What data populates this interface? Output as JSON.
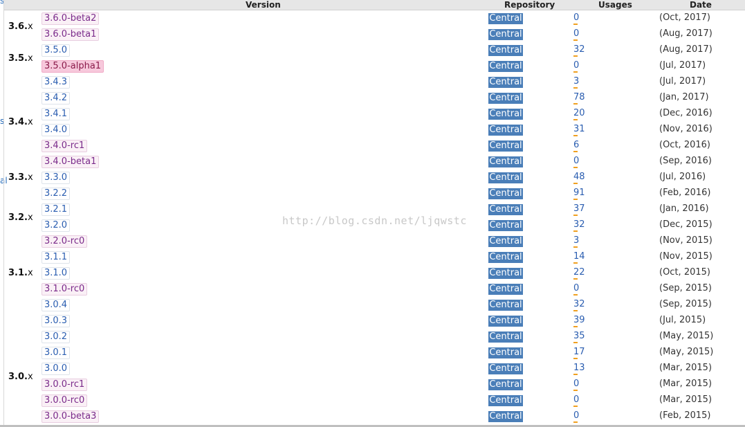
{
  "headers": {
    "version": "Version",
    "repository": "Repository",
    "usages": "Usages",
    "date": "Date"
  },
  "edge_text": [
    "s",
    "s",
    "al"
  ],
  "watermark": "http://blog.csdn.net/ljqwstc",
  "groups": [
    {
      "major": "3.6.",
      "suffix": "x"
    },
    {
      "major": "3.5.",
      "suffix": "x"
    },
    {
      "major": "3.4.",
      "suffix": "x"
    },
    {
      "major": "3.3.",
      "suffix": "x"
    },
    {
      "major": "3.2.",
      "suffix": "x"
    },
    {
      "major": "3.1.",
      "suffix": "x"
    },
    {
      "major": "3.0.",
      "suffix": "x"
    }
  ],
  "rows": [
    {
      "version": "3.6.0-beta2",
      "kind": "pre",
      "repository": "Central",
      "usages": "0",
      "date": "(Oct, 2017)"
    },
    {
      "version": "3.6.0-beta1",
      "kind": "pre",
      "repository": "Central",
      "usages": "0",
      "date": "(Aug, 2017)"
    },
    {
      "version": "3.5.0",
      "kind": "release",
      "repository": "Central",
      "usages": "32",
      "date": "(Aug, 2017)"
    },
    {
      "version": "3.5.0-alpha1",
      "kind": "alpha",
      "repository": "Central",
      "usages": "0",
      "date": "(Jul, 2017)"
    },
    {
      "version": "3.4.3",
      "kind": "release",
      "repository": "Central",
      "usages": "3",
      "date": "(Jul, 2017)"
    },
    {
      "version": "3.4.2",
      "kind": "release",
      "repository": "Central",
      "usages": "78",
      "date": "(Jan, 2017)"
    },
    {
      "version": "3.4.1",
      "kind": "release",
      "repository": "Central",
      "usages": "20",
      "date": "(Dec, 2016)"
    },
    {
      "version": "3.4.0",
      "kind": "release",
      "repository": "Central",
      "usages": "31",
      "date": "(Nov, 2016)"
    },
    {
      "version": "3.4.0-rc1",
      "kind": "pre",
      "repository": "Central",
      "usages": "6",
      "date": "(Oct, 2016)"
    },
    {
      "version": "3.4.0-beta1",
      "kind": "pre",
      "repository": "Central",
      "usages": "0",
      "date": "(Sep, 2016)"
    },
    {
      "version": "3.3.0",
      "kind": "release",
      "repository": "Central",
      "usages": "48",
      "date": "(Jul, 2016)"
    },
    {
      "version": "3.2.2",
      "kind": "release",
      "repository": "Central",
      "usages": "91",
      "date": "(Feb, 2016)"
    },
    {
      "version": "3.2.1",
      "kind": "release",
      "repository": "Central",
      "usages": "37",
      "date": "(Jan, 2016)"
    },
    {
      "version": "3.2.0",
      "kind": "release",
      "repository": "Central",
      "usages": "32",
      "date": "(Dec, 2015)"
    },
    {
      "version": "3.2.0-rc0",
      "kind": "pre",
      "repository": "Central",
      "usages": "3",
      "date": "(Nov, 2015)"
    },
    {
      "version": "3.1.1",
      "kind": "release",
      "repository": "Central",
      "usages": "14",
      "date": "(Nov, 2015)"
    },
    {
      "version": "3.1.0",
      "kind": "release",
      "repository": "Central",
      "usages": "22",
      "date": "(Oct, 2015)"
    },
    {
      "version": "3.1.0-rc0",
      "kind": "pre",
      "repository": "Central",
      "usages": "0",
      "date": "(Sep, 2015)"
    },
    {
      "version": "3.0.4",
      "kind": "release",
      "repository": "Central",
      "usages": "32",
      "date": "(Sep, 2015)"
    },
    {
      "version": "3.0.3",
      "kind": "release",
      "repository": "Central",
      "usages": "39",
      "date": "(Jul, 2015)"
    },
    {
      "version": "3.0.2",
      "kind": "release",
      "repository": "Central",
      "usages": "35",
      "date": "(May, 2015)"
    },
    {
      "version": "3.0.1",
      "kind": "release",
      "repository": "Central",
      "usages": "17",
      "date": "(May, 2015)"
    },
    {
      "version": "3.0.0",
      "kind": "release",
      "repository": "Central",
      "usages": "13",
      "date": "(Mar, 2015)"
    },
    {
      "version": "3.0.0-rc1",
      "kind": "pre",
      "repository": "Central",
      "usages": "0",
      "date": "(Mar, 2015)"
    },
    {
      "version": "3.0.0-rc0",
      "kind": "pre",
      "repository": "Central",
      "usages": "0",
      "date": "(Mar, 2015)"
    },
    {
      "version": "3.0.0-beta3",
      "kind": "pre",
      "repository": "Central",
      "usages": "0",
      "date": "(Feb, 2015)"
    }
  ],
  "colors": {
    "repo_badge": "#4a7eb8",
    "usage_bar": "#f0a020",
    "link": "#2a5db0",
    "alpha_bg": "#f7c9dc",
    "pre_bg": "#faf0f6"
  }
}
